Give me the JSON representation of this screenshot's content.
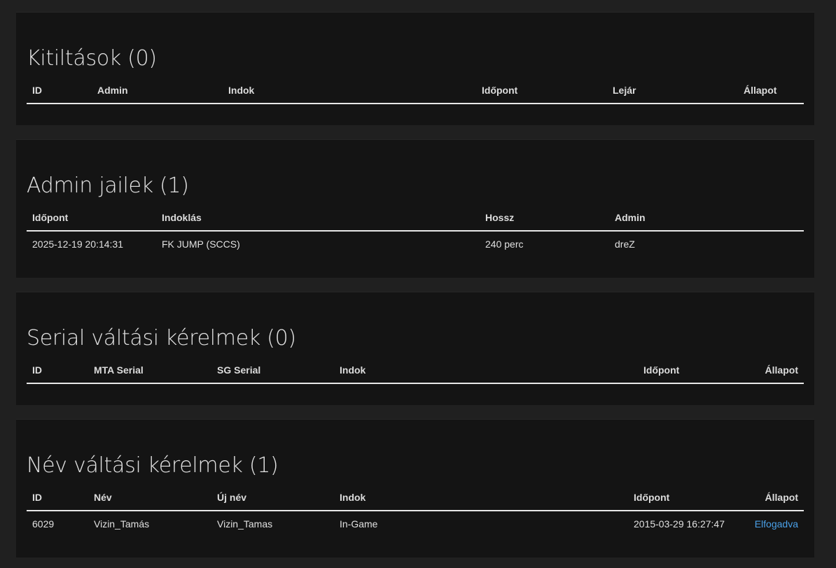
{
  "bans": {
    "title": "Kitiltások (0)",
    "headers": [
      "ID",
      "Admin",
      "Indok",
      "Időpont",
      "Lejár",
      "Állapot"
    ]
  },
  "jails": {
    "title": "Admin jailek (1)",
    "headers": [
      "Időpont",
      "Indoklás",
      "Hossz",
      "Admin"
    ],
    "rows": [
      [
        "2025-12-19 20:14:31",
        "FK JUMP (SCCS)",
        "240 perc",
        "dreZ"
      ]
    ]
  },
  "serials": {
    "title": "Serial váltási kérelmek (0)",
    "headers": [
      "ID",
      "MTA Serial",
      "SG Serial",
      "Indok",
      "Időpont",
      "Állapot"
    ]
  },
  "names": {
    "title": "Név váltási kérelmek (1)",
    "headers": [
      "ID",
      "Név",
      "Új név",
      "Indok",
      "Időpont",
      "Állapot"
    ],
    "rows": [
      [
        "6029",
        "Vizin_Tamás",
        "Vizin_Tamas",
        "In-Game",
        "2015-03-29 16:27:47",
        "Elfogadva"
      ]
    ]
  },
  "colors": {
    "page_bg": "#202020",
    "panel_bg": "#141414",
    "link": "#3c8ed6",
    "status_link": "#4aa0e8"
  }
}
